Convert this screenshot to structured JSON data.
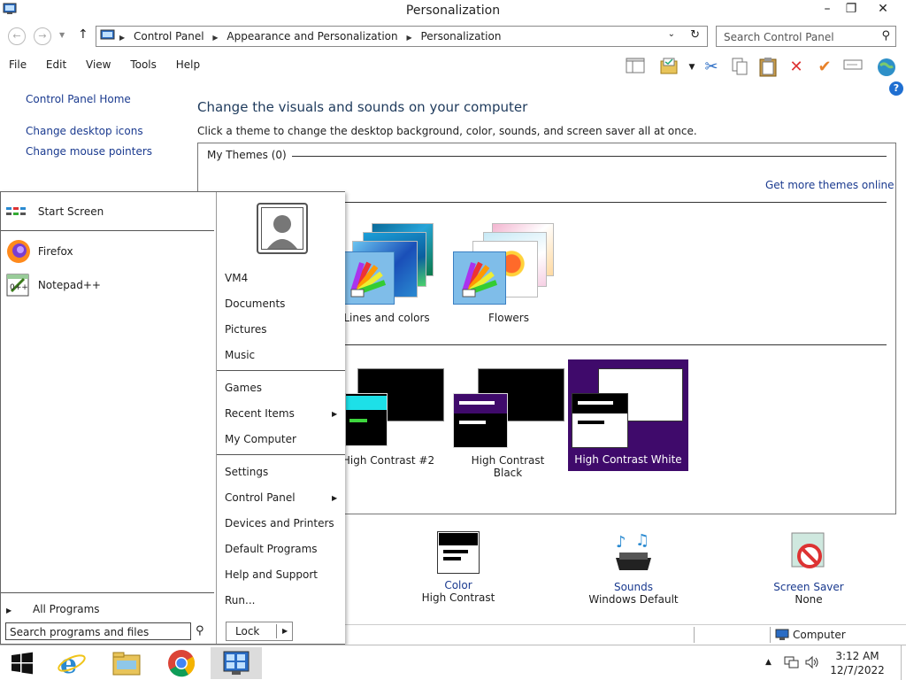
{
  "window": {
    "title": "Personalization",
    "minimize": "–",
    "maximize": "❐",
    "close": "✕"
  },
  "address": {
    "crumbs": [
      "Control Panel",
      "Appearance and Personalization",
      "Personalization"
    ],
    "search_placeholder": "Search Control Panel"
  },
  "menu": {
    "file": "File",
    "edit": "Edit",
    "view": "View",
    "tools": "Tools",
    "help": "Help"
  },
  "left_nav": {
    "home": "Control Panel Home",
    "desktop_icons": "Change desktop icons",
    "mouse_pointers": "Change mouse pointers"
  },
  "main": {
    "heading": "Change the visuals and sounds on your computer",
    "subtitle": "Click a theme to change the desktop background, color, sounds, and screen saver all at once.",
    "my_themes": "My Themes (0)",
    "get_more": "Get more themes online",
    "themes": {
      "lines": "Lines and colors",
      "flowers": "Flowers",
      "hc2": "High Contrast #2",
      "hcblack": "High Contrast Black",
      "hcwhite": "High Contrast White"
    }
  },
  "bottom": {
    "color_label": "Color",
    "color_value": "High Contrast",
    "sounds_label": "Sounds",
    "sounds_value": "Windows Default",
    "saver_label": "Screen Saver",
    "saver_value": "None"
  },
  "status": {
    "computer": "Computer"
  },
  "start_menu": {
    "pinned": [
      "Start Screen",
      "Firefox",
      "Notepad++"
    ],
    "all_programs": "All Programs",
    "search_placeholder": "Search programs and files",
    "user": "VM4",
    "right_group1": [
      "Documents",
      "Pictures",
      "Music"
    ],
    "right_group2": [
      "Games",
      "Recent Items",
      "My Computer"
    ],
    "right_group3": [
      "Settings",
      "Control Panel",
      "Devices and Printers",
      "Default Programs",
      "Help and Support",
      "Run..."
    ],
    "lock": "Lock"
  },
  "taskbar": {
    "time": "3:12 AM",
    "date": "12/7/2022"
  },
  "colors": {
    "link": "#1a3a8f",
    "hc_white_selected_bg": "#3f0a6b",
    "taskbar_active": "#dcdcdc"
  }
}
